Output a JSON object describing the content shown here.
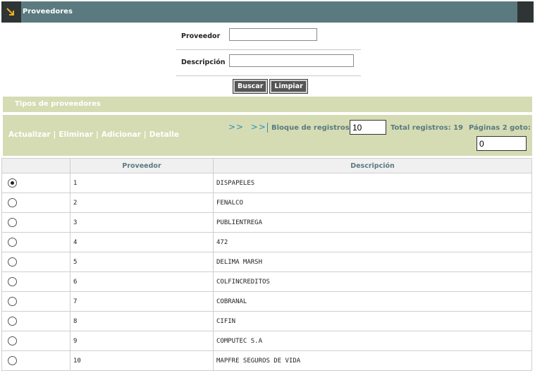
{
  "header": {
    "title": "Proveedores"
  },
  "form": {
    "proveedor_label": "Proveedor",
    "proveedor_value": "",
    "descripcion_label": "Descripción",
    "descripcion_value": ""
  },
  "buttons": {
    "buscar": "Buscar",
    "limpiar": "Limpiar"
  },
  "section": {
    "title": "Tipos de proveedores"
  },
  "actions": {
    "actualizar": "Actualizar",
    "eliminar": "Eliminar",
    "adicionar": "Adicionar",
    "detalle": "Detalle",
    "separator": "|"
  },
  "pager": {
    "next": ">>",
    "last": ">>",
    "block_label": "Bloque de registros:",
    "block_value": "10",
    "total_label": "Total registros: 19",
    "pages_label": "Páginas 2 goto:",
    "goto_value": "0"
  },
  "table": {
    "columns": [
      "",
      "Proveedor",
      "Descripción"
    ],
    "rows": [
      {
        "selected": true,
        "id": "1",
        "desc": "DISPAPELES"
      },
      {
        "selected": false,
        "id": "2",
        "desc": "FENALCO"
      },
      {
        "selected": false,
        "id": "3",
        "desc": "PUBLIENTREGA"
      },
      {
        "selected": false,
        "id": "4",
        "desc": "472"
      },
      {
        "selected": false,
        "id": "5",
        "desc": "DELIMA MARSH"
      },
      {
        "selected": false,
        "id": "6",
        "desc": "COLFINCREDITOS"
      },
      {
        "selected": false,
        "id": "7",
        "desc": "COBRANAL"
      },
      {
        "selected": false,
        "id": "8",
        "desc": "CIFIN"
      },
      {
        "selected": false,
        "id": "9",
        "desc": "COMPUTEC S.A"
      },
      {
        "selected": false,
        "id": "10",
        "desc": "MAPFRE SEGUROS DE VIDA"
      }
    ]
  },
  "colors": {
    "header_bg": "#5b7a80",
    "bar_bg": "#d5dcb3",
    "link": "#2f8fbf"
  },
  "icons": {
    "header": "arrow-down-right-icon"
  }
}
